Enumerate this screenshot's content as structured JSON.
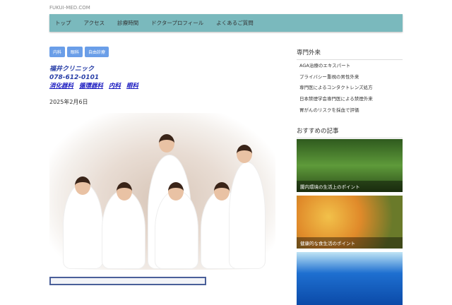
{
  "site": {
    "name": "FUKUI-MED.COM"
  },
  "nav": [
    "トップ",
    "アクセス",
    "診療時間",
    "ドクタープロフィール",
    "よくあるご質問"
  ],
  "tags": [
    "内科",
    "眼科",
    "自由診療"
  ],
  "clinic": {
    "name": "福井クリニック",
    "phone": "078-612-0101",
    "departments": [
      "消化器科",
      "循環器科",
      "内科",
      "眼科"
    ]
  },
  "date": "2025年2月6日",
  "sidebar": {
    "specialty_title": "専門外来",
    "specialty_items": [
      "AGA治療のエキスパート",
      "プライバシー重視の男性外来",
      "専門医によるコンタクトレンズ処方",
      "日本禁煙学会専門医による禁煙外来",
      "胃がんのリスクを採血で評価"
    ],
    "recommended_title": "おすすめの記事",
    "articles": [
      "腸内環境の生活上のポイント",
      "健康的な食生活のポイント"
    ]
  }
}
